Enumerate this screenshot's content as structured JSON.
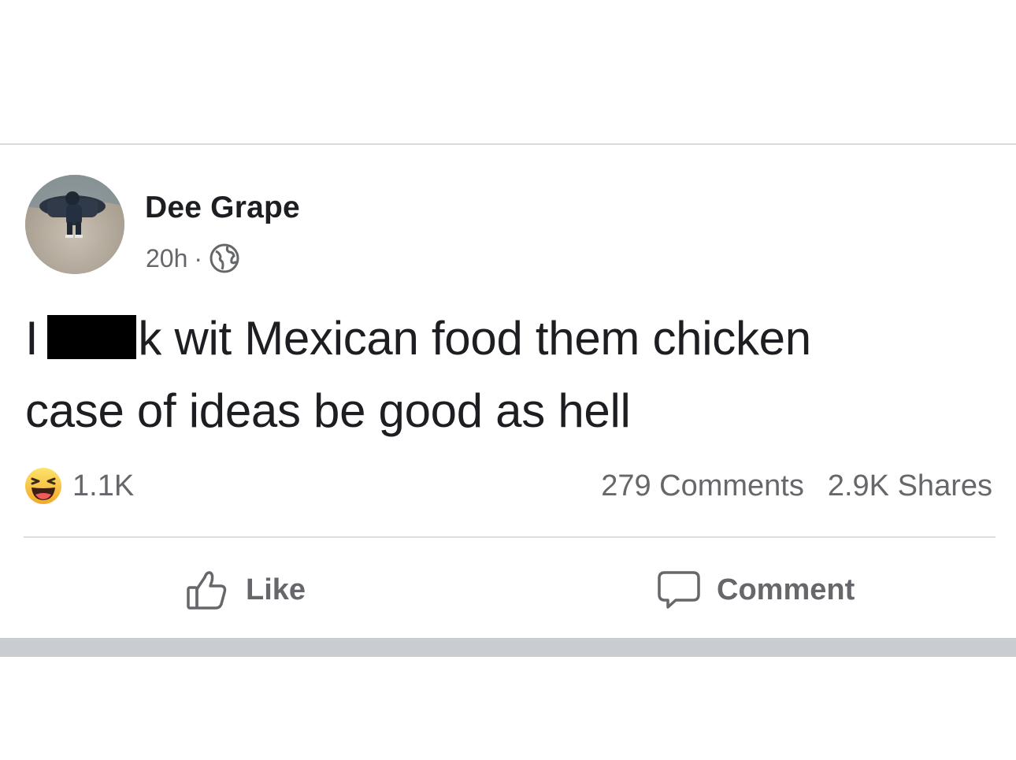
{
  "post": {
    "author": {
      "name": "Dee Grape",
      "avatar_icon": "profile-photo"
    },
    "meta": {
      "time": "20h",
      "separator": "·",
      "audience_icon": "globe-icon"
    },
    "text": {
      "line1_start": "I",
      "line1_end": "k wit Mexican food them chicken",
      "line2": "case of ideas be good as hell"
    },
    "reactions": {
      "icon": "haha-icon",
      "count": "1.1K"
    },
    "stats": {
      "comments": "279 Comments",
      "shares": "2.9K Shares"
    },
    "actions": {
      "like_label": "Like",
      "comment_label": "Comment"
    }
  },
  "colors": {
    "primary_text": "#1c1e21",
    "secondary_text": "#65676b",
    "divider": "#dadde1",
    "haha_yellow": "#f7c12d"
  }
}
